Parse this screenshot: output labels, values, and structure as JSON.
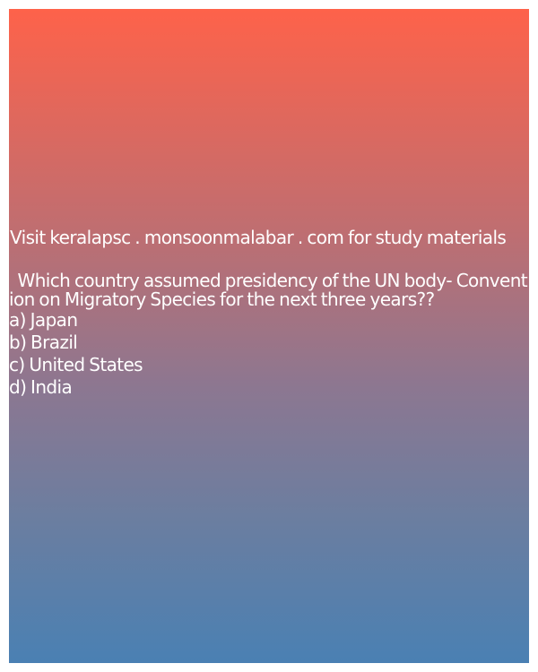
{
  "promo": {
    "text": "Visit keralapsc . monsoonmalabar . com for study materials"
  },
  "question": {
    "text": "  Which country assumed presidency of the UN body- Convention on Migratory Species for the next three years??",
    "options": [
      "a) Japan",
      "b) Brazil",
      "c) United States",
      "d) India"
    ]
  },
  "colors": {
    "gradient_top": "#fe624a",
    "gradient_bottom": "#4a80b3",
    "text": "#ffffff"
  }
}
